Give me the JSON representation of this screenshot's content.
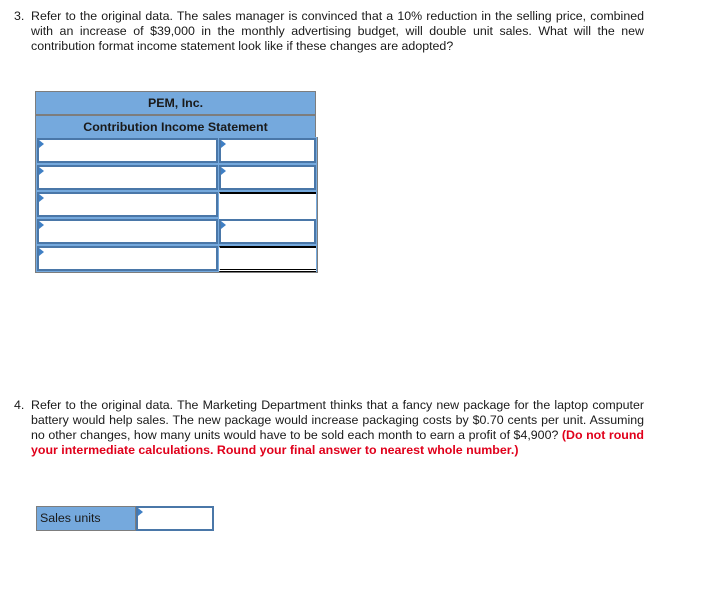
{
  "question3": {
    "number": "3.",
    "text": "Refer to the original data. The sales manager is convinced that a 10% reduction in the selling price, combined with an increase of $39,000 in the monthly advertising budget, will double unit sales. What will the new contribution format income statement look like if these changes are adopted?"
  },
  "statement": {
    "company": "PEM, Inc.",
    "title": "Contribution Income Statement",
    "rows": [
      {
        "label": "",
        "amount": "",
        "amount_input": true
      },
      {
        "label": "",
        "amount": "",
        "amount_input": true
      },
      {
        "label": "",
        "amount": "",
        "amount_input": false
      },
      {
        "label": "",
        "amount": "",
        "amount_input": true
      },
      {
        "label": "",
        "amount": "",
        "amount_input": false,
        "total": true
      }
    ]
  },
  "question4": {
    "number": "4.",
    "text": "Refer to the original data. The Marketing Department thinks that a fancy new package for the laptop computer battery would help sales. The new package would increase packaging costs by $0.70 cents per unit. Assuming no other changes, how many units would have to be sold each month to earn a profit of $4,900?",
    "instruction": "(Do not round your intermediate calculations. Round your final answer to nearest whole number.)"
  },
  "answer": {
    "label": "Sales units",
    "value": ""
  },
  "colors": {
    "header_fill": "#75a9dd",
    "input_border": "#4a77a8",
    "instruction_red": "#e0001b"
  }
}
